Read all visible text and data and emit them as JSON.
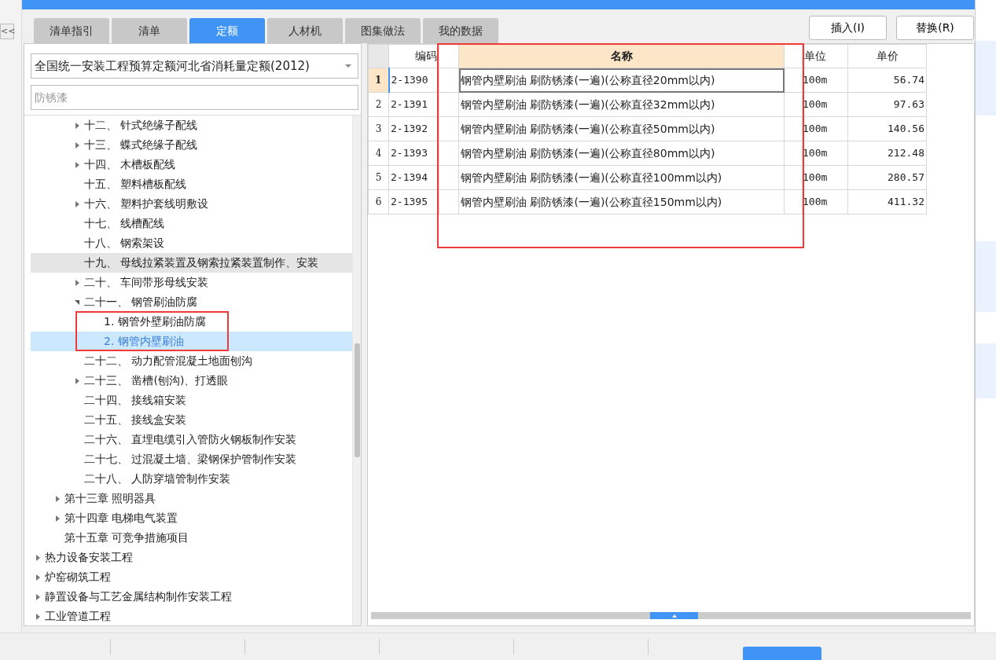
{
  "tabs": [
    {
      "label": "清单指引",
      "selected": false
    },
    {
      "label": "清单",
      "selected": false
    },
    {
      "label": "定额",
      "selected": true
    },
    {
      "label": "人材机",
      "selected": false
    },
    {
      "label": "图集做法",
      "selected": false
    },
    {
      "label": "我的数据",
      "selected": false
    }
  ],
  "buttons": [
    "插入(I)",
    "替换(R)"
  ],
  "side_toggle": "<<",
  "norm_select": {
    "value": "全国统一安装工程预算定额河北省消耗量定额(2012)"
  },
  "search": {
    "placeholder": "防锈漆"
  },
  "tree": [
    {
      "children": [
        {
          "children": [
            {
              "label": "十二、 针式绝缘子配线",
              "expanded": false,
              "selected": false,
              "hovered": false
            },
            {
              "label": "十三、 蝶式绝缘子配线",
              "expanded": false,
              "selected": false,
              "hovered": false
            },
            {
              "label": "十四、 木槽板配线",
              "expanded": false,
              "selected": false,
              "hovered": false
            },
            {
              "label": "十五、 塑料槽板配线",
              "selected": false,
              "hovered": false
            },
            {
              "label": "十六、 塑料护套线明敷设",
              "expanded": false,
              "selected": false,
              "hovered": false
            },
            {
              "label": "十七、 线槽配线",
              "selected": false,
              "hovered": false
            },
            {
              "label": "十八、 钢索架设",
              "selected": false,
              "hovered": false
            },
            {
              "label": "十九、 母线拉紧装置及钢索拉紧装置制作、安装",
              "selected": false,
              "hovered": true
            },
            {
              "label": "二十、 车间带形母线安装",
              "expanded": false,
              "selected": false,
              "hovered": false
            },
            {
              "label": "二十一、 钢管刷油防腐",
              "expanded": true,
              "selected": false,
              "hovered": false,
              "children": [
                {
                  "label": "1. 钢管外壁刷油防腐",
                  "selected": false,
                  "hovered": false
                },
                {
                  "label": "2. 钢管内壁刷油",
                  "selected": true,
                  "hovered": false
                }
              ]
            },
            {
              "label": "二十二、 动力配管混凝土地面刨沟",
              "selected": false,
              "hovered": false
            },
            {
              "label": "二十三、 凿槽(刨沟)、打透眼",
              "expanded": false,
              "selected": false,
              "hovered": false
            },
            {
              "label": "二十四、 接线箱安装",
              "selected": false,
              "hovered": false
            },
            {
              "label": "二十五、 接线盒安装",
              "selected": false,
              "hovered": false
            },
            {
              "label": "二十六、 直埋电缆引入管防火钢板制作安装",
              "selected": false,
              "hovered": false
            },
            {
              "label": "二十七、 过混凝土墙、梁钢保护管制作安装",
              "selected": false,
              "hovered": false
            },
            {
              "label": "二十八、 人防穿墙管制作安装",
              "selected": false,
              "hovered": false
            }
          ]
        },
        {
          "label": "第十三章 照明器具",
          "expanded": false,
          "selected": false,
          "hovered": false
        },
        {
          "label": "第十四章 电梯电气装置",
          "expanded": false,
          "selected": false,
          "hovered": false
        },
        {
          "label": "第十五章 可竞争措施项目",
          "selected": false,
          "hovered": false
        }
      ]
    },
    {
      "label": "热力设备安装工程",
      "expanded": false,
      "selected": false,
      "hovered": false
    },
    {
      "label": "炉窑砌筑工程",
      "expanded": false,
      "selected": false,
      "hovered": false
    },
    {
      "label": "静置设备与工艺金属结构制作安装工程",
      "expanded": false,
      "selected": false,
      "hovered": false
    },
    {
      "label": "工业管道工程",
      "expanded": false,
      "selected": false,
      "hovered": false
    }
  ],
  "table": {
    "columns": [
      {
        "label": "编码",
        "selected": false
      },
      {
        "selected": false
      },
      {
        "label": "名称",
        "selected": true
      },
      {
        "selected": false
      },
      {
        "label": "单位",
        "selected": false
      },
      {
        "label": "单价",
        "selected": false
      }
    ],
    "rows": [
      {
        "number": "1",
        "selected": true,
        "cells": [
          "2-1390",
          "",
          "钢管内壁刷油 刷防锈漆(一遍)(公称直径20mm以内)",
          "",
          "100m",
          "56.74"
        ]
      },
      {
        "number": "2",
        "selected": false,
        "cells": [
          "2-1391",
          "",
          "钢管内壁刷油 刷防锈漆(一遍)(公称直径32mm以内)",
          "",
          "100m",
          "97.63"
        ]
      },
      {
        "number": "3",
        "selected": false,
        "cells": [
          "2-1392",
          "",
          "钢管内壁刷油 刷防锈漆(一遍)(公称直径50mm以内)",
          "",
          "100m",
          "140.56"
        ]
      },
      {
        "number": "4",
        "selected": false,
        "cells": [
          "2-1393",
          "",
          "钢管内壁刷油 刷防锈漆(一遍)(公称直径80mm以内)",
          "",
          "100m",
          "212.48"
        ]
      },
      {
        "number": "5",
        "selected": false,
        "cells": [
          "2-1394",
          "",
          "钢管内壁刷油 刷防锈漆(一遍)(公称直径100mm以内)",
          "",
          "100m",
          "280.57"
        ]
      },
      {
        "number": "6",
        "selected": false,
        "cells": [
          "2-1395",
          "",
          "钢管内壁刷油 刷防锈漆(一遍)(公称直径150mm以内)",
          "",
          "100m",
          "411.32"
        ]
      }
    ]
  }
}
